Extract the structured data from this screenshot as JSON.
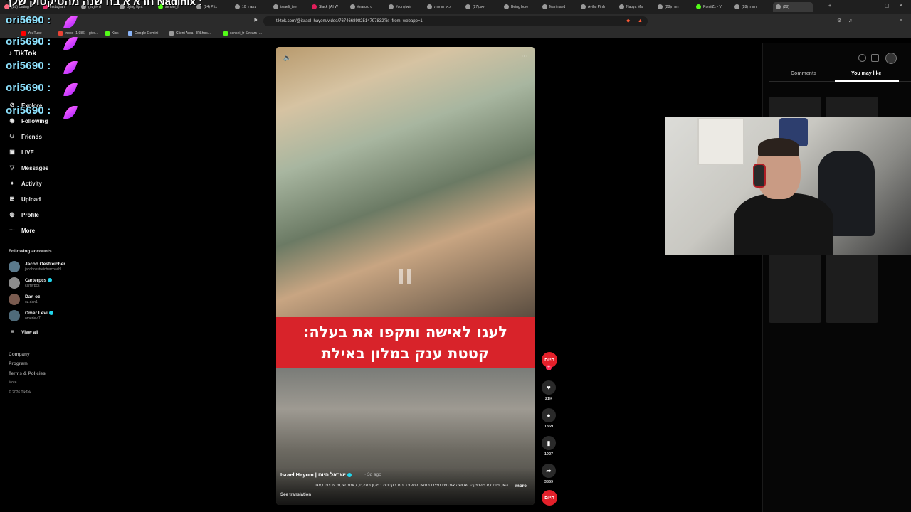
{
  "overlay": {
    "top_text": "חרא א בח שנה מהטיקטוק שלך  Nadinix :",
    "chat_lines": [
      "ori5690 :",
      "ori5690 :",
      "ori5690 :",
      "ori5690 :",
      "ori5690 :"
    ]
  },
  "browser": {
    "tabs": [
      {
        "label": "(28) Dating",
        "color": "#ff6b81"
      },
      {
        "label": "Instagram",
        "color": "#e1306c"
      },
      {
        "label": "(28) #nfl",
        "color": "#9a9a9a"
      },
      {
        "label": "dying light",
        "color": "#9a9a9a"
      },
      {
        "label": "sensei_fr",
        "color": "#53fc18"
      },
      {
        "label": "(24) Prix",
        "color": "#9a9a9a"
      },
      {
        "label": "10 משרד",
        "color": "#9a9a9a"
      },
      {
        "label": "israeli_tee",
        "color": "#9a9a9a"
      },
      {
        "label": "Slack | AI W",
        "color": "#e01e5a"
      },
      {
        "label": "#naruto o",
        "color": "#9a9a9a"
      },
      {
        "label": "#sonytwin",
        "color": "#9a9a9a"
      },
      {
        "label": "כאן חדשות",
        "color": "#9a9a9a"
      },
      {
        "label": "יואב(27)",
        "color": "#9a9a9a"
      },
      {
        "label": "Being bore",
        "color": "#9a9a9a"
      },
      {
        "label": "Marin and",
        "color": "#9a9a9a"
      },
      {
        "label": "Avihu Pinh",
        "color": "#9a9a9a"
      },
      {
        "label": "Naoya Ma",
        "color": "#9a9a9a"
      },
      {
        "label": "חזרה(28)",
        "color": "#9a9a9a"
      },
      {
        "label": "RoniiiZz - V",
        "color": "#53fc18"
      },
      {
        "label": "(28) חזרה",
        "color": "#9a9a9a"
      },
      {
        "label": "(28)",
        "color": "#9a9a9a"
      }
    ],
    "url": "tiktok.com/@israel_hayom/video/7674668982514797832?is_from_webapp=1",
    "bookmarks": [
      {
        "label": "YouTube",
        "color": "#ff0000"
      },
      {
        "label": "Inbox (1,986) - givo...",
        "color": "#ea4335"
      },
      {
        "label": "Kick",
        "color": "#53fc18"
      },
      {
        "label": "Google Gemini",
        "color": "#8ab4f8"
      },
      {
        "label": "Client Area - IRLhos...",
        "color": "#9a9a9a"
      },
      {
        "label": "sensei_fr Stream -...",
        "color": "#53fc18"
      }
    ]
  },
  "sidebar": {
    "logo": "TikTok",
    "nav": [
      {
        "label": "Explore",
        "icon": "compass-icon"
      },
      {
        "label": "Following",
        "icon": "following-icon"
      },
      {
        "label": "Friends",
        "icon": "friends-icon"
      },
      {
        "label": "LIVE",
        "icon": "live-icon"
      },
      {
        "label": "Messages",
        "icon": "messages-icon"
      },
      {
        "label": "Activity",
        "icon": "activity-icon"
      },
      {
        "label": "Upload",
        "icon": "upload-icon"
      },
      {
        "label": "Profile",
        "icon": "profile-icon"
      },
      {
        "label": "More",
        "icon": "more-icon"
      }
    ],
    "following_header": "Following accounts",
    "accounts": [
      {
        "name": "Jacob Oestreicher",
        "handle": "jacoboestreichercoachl...",
        "verified": false
      },
      {
        "name": "Carterpcs",
        "handle": "carterpcs",
        "verified": true
      },
      {
        "name": "Dan oz",
        "handle": "oz.dan1",
        "verified": false
      },
      {
        "name": "Omer Levi",
        "handle": "omerlevi7",
        "verified": true
      }
    ],
    "view_all": "View all",
    "footer": [
      "Company",
      "Program",
      "Terms & Policies"
    ],
    "footer_more": "More",
    "copyright": "© 2026 TikTok"
  },
  "video": {
    "banner_line1": "לעגו לאישה ותקפו את בעלה:",
    "banner_line2": "קטטת ענק במלון באילת",
    "author": "Israel Hayom | ישראל היום",
    "date": "· 3d ago",
    "description": "האלימות לא מפסיקה: שלושה אורחים נעצרו בחשד למעורבותם בקטטה במלון באילת, לאחר שלפי עדויות לעגו",
    "more": "more",
    "see_translation": "See translation"
  },
  "actions": {
    "channel_badge": "היום",
    "likes": "21K",
    "comments": "1359",
    "saves": "1927",
    "shares": "3859"
  },
  "right_panel": {
    "tabs": [
      "Comments",
      "You may like"
    ],
    "active_tab": "You may like"
  }
}
